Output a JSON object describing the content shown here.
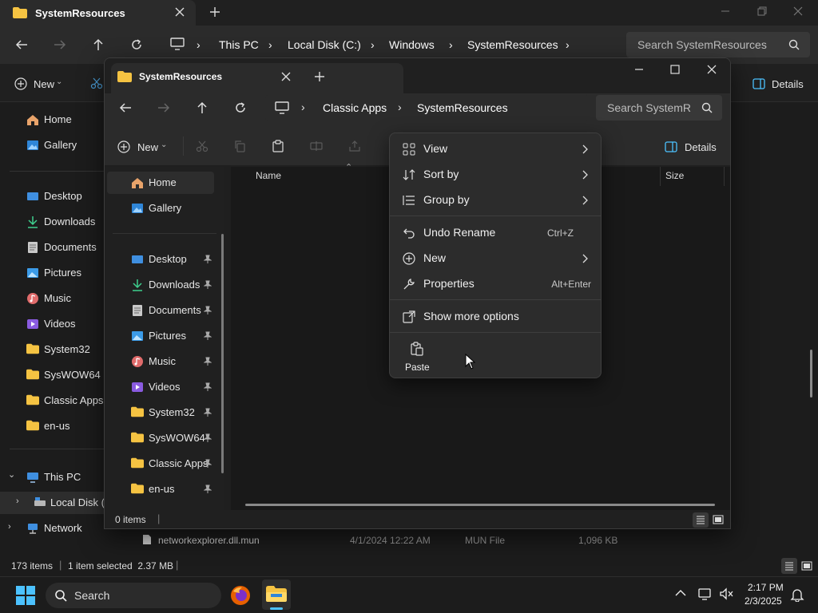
{
  "back_window": {
    "tab_title": "SystemResources",
    "breadcrumbs": [
      "This PC",
      "Local Disk (C:)",
      "Windows",
      "SystemResources"
    ],
    "search_placeholder": "Search SystemResources",
    "new_label": "New",
    "details_label": "Details",
    "nav_items": [
      {
        "label": "Home",
        "icon": "home-icon"
      },
      {
        "label": "Gallery",
        "icon": "gallery-icon"
      },
      {
        "label": "Desktop",
        "icon": "desktop-icon"
      },
      {
        "label": "Downloads",
        "icon": "download-icon"
      },
      {
        "label": "Documents",
        "icon": "document-icon"
      },
      {
        "label": "Pictures",
        "icon": "pictures-icon"
      },
      {
        "label": "Music",
        "icon": "music-icon"
      },
      {
        "label": "Videos",
        "icon": "videos-icon"
      },
      {
        "label": "System32",
        "icon": "folder-icon"
      },
      {
        "label": "SysWOW64",
        "icon": "folder-icon"
      },
      {
        "label": "Classic Apps",
        "icon": "folder-icon"
      },
      {
        "label": "en-us",
        "icon": "folder-icon"
      },
      {
        "label": "This PC",
        "icon": "pc-icon"
      },
      {
        "label": "Local Disk (C",
        "icon": "drive-icon"
      },
      {
        "label": "Network",
        "icon": "network-icon"
      }
    ],
    "file_row": {
      "name": "networkexplorer.dll.mun",
      "date": "4/1/2024 12:22 AM",
      "type": "MUN File",
      "size": "1,096 KB"
    },
    "status": {
      "items": "173 items",
      "selected": "1 item selected  2.37 MB"
    }
  },
  "front_window": {
    "tab_title": "SystemResources",
    "breadcrumbs": [
      "Classic Apps",
      "SystemResources"
    ],
    "search_placeholder": "Search SystemR",
    "new_label": "New",
    "details_label": "Details",
    "columns": {
      "name": "Name",
      "size": "Size"
    },
    "nav_items": [
      {
        "label": "Home",
        "icon": "home-icon"
      },
      {
        "label": "Gallery",
        "icon": "gallery-icon"
      },
      {
        "label": "Desktop",
        "icon": "desktop-icon"
      },
      {
        "label": "Downloads",
        "icon": "download-icon"
      },
      {
        "label": "Documents",
        "icon": "document-icon"
      },
      {
        "label": "Pictures",
        "icon": "pictures-icon"
      },
      {
        "label": "Music",
        "icon": "music-icon"
      },
      {
        "label": "Videos",
        "icon": "videos-icon"
      },
      {
        "label": "System32",
        "icon": "folder-icon"
      },
      {
        "label": "SysWOW64",
        "icon": "folder-icon"
      },
      {
        "label": "Classic Apps",
        "icon": "folder-icon"
      },
      {
        "label": "en-us",
        "icon": "folder-icon"
      }
    ],
    "status": {
      "items": "0 items"
    }
  },
  "context_menu": {
    "view": "View",
    "sort_by": "Sort by",
    "group_by": "Group by",
    "undo_rename": "Undo Rename",
    "undo_shortcut": "Ctrl+Z",
    "new": "New",
    "properties": "Properties",
    "properties_shortcut": "Alt+Enter",
    "show_more": "Show more options",
    "paste": "Paste"
  },
  "taskbar": {
    "search_label": "Search",
    "time": "2:17 PM",
    "date": "2/3/2025"
  },
  "colors": {
    "accent": "#4cc2ff",
    "folder": "#f5c342"
  }
}
